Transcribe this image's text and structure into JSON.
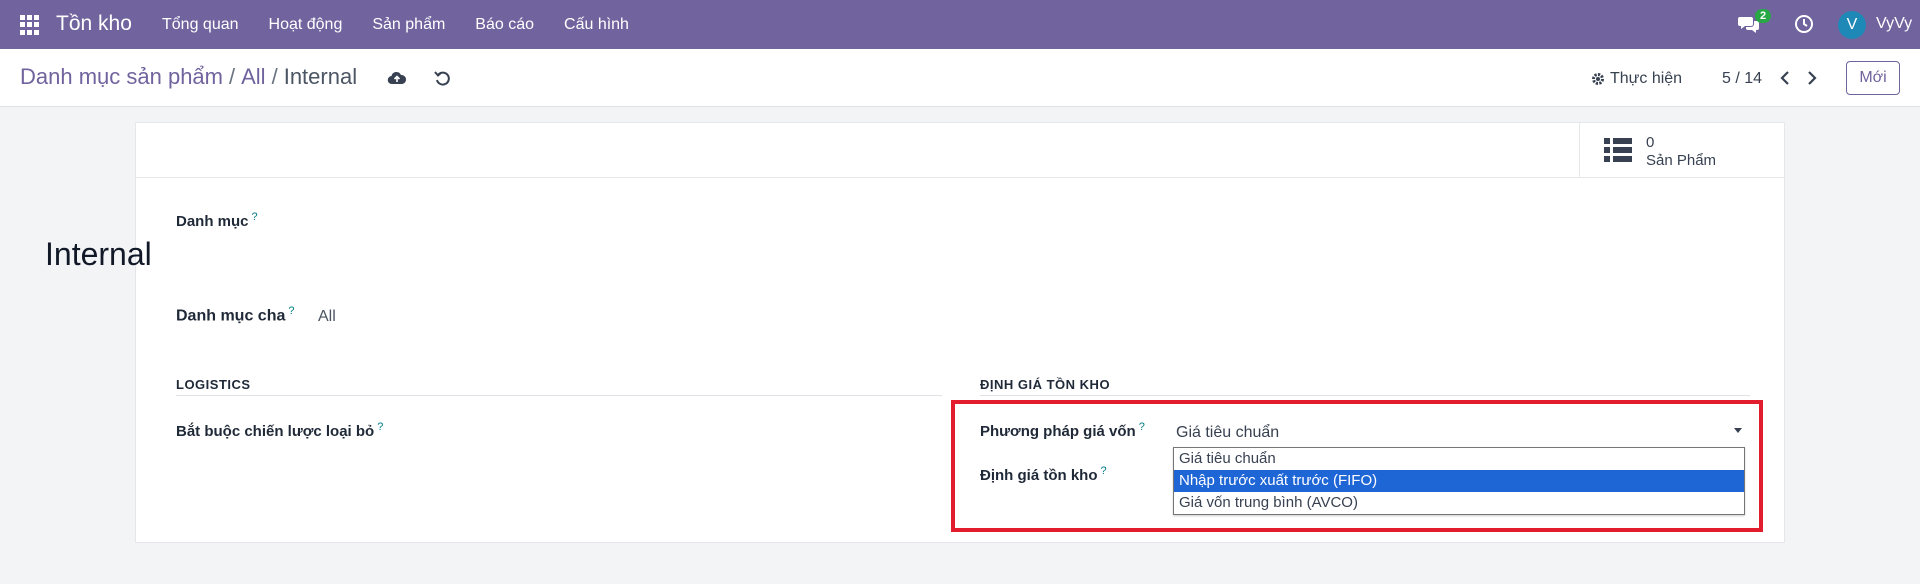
{
  "navbar": {
    "app_title": "Tồn kho",
    "menu": [
      "Tổng quan",
      "Hoạt động",
      "Sản phẩm",
      "Báo cáo",
      "Cấu hình"
    ],
    "chat_badge": "2",
    "avatar_letter": "V",
    "username": "VyVy"
  },
  "control": {
    "breadcrumb": [
      "Danh mục sản phẩm",
      "All",
      "Internal"
    ],
    "action_label": "Thực hiện",
    "pager": "5 / 14",
    "new_label": "Mới"
  },
  "stat_button": {
    "count": "0",
    "label": "Sản Phẩm"
  },
  "form": {
    "name_label": "Danh mục",
    "name_value": "Internal",
    "parent_label": "Danh mục cha",
    "parent_value": "All",
    "logistics_title": "LOGISTICS",
    "removal_label": "Bắt buộc chiến lược loại bỏ",
    "valuation_title": "ĐỊNH GIÁ TỒN KHO",
    "cost_method_label": "Phương pháp giá vốn",
    "cost_method_value": "Giá tiêu chuẩn",
    "valuation_label": "Định giá tồn kho",
    "help_mark": "?",
    "options": [
      "Giá tiêu chuẩn",
      "Nhập trước xuất trước (FIFO)",
      "Giá vốn trung bình (AVCO)"
    ],
    "selected_option_index": 1
  },
  "colors": {
    "navbar": "#71639e",
    "highlight": "#e11d2e",
    "selected_option": "#1e66d6",
    "help": "#017e84"
  }
}
